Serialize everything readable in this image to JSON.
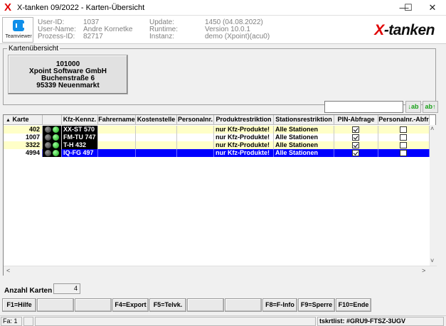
{
  "window": {
    "title": "X-tanken 09/2022 - Karten-Übersicht",
    "app_glyph": "X",
    "controls": {
      "minimize": "—",
      "maximize": "☐",
      "close": "✕"
    }
  },
  "header": {
    "teamviewer_label": "Teamviewer",
    "fields": [
      {
        "label": "User-ID:",
        "value": "1037"
      },
      {
        "label": "User-Name:",
        "value": "Andre Kornetke"
      },
      {
        "label": "Prozess-ID:",
        "value": "82717"
      },
      {
        "label": "Update:",
        "value": "1450 (04.08.2022)"
      },
      {
        "label": "Runtime:",
        "value": "Version 10.0.1"
      },
      {
        "label": "Instanz:",
        "value": "demo (Xpoint)(acu0)"
      }
    ],
    "brand_x": "X",
    "brand_rest": "-tanken"
  },
  "overview": {
    "group_title": "Kartenübersicht",
    "address": [
      "101000",
      "Xpoint Software GmbH",
      "Buchenstraße 6",
      "95339 Neuenmarkt"
    ]
  },
  "search": {
    "value": "",
    "sort_down_label": "↓ab",
    "sort_up_label": "ab↑"
  },
  "grid": {
    "sort_glyph": "▲",
    "columns": [
      "Karte",
      "",
      "Kfz-Kennz.",
      "Fahrername",
      "Kostenstelle",
      "Personalnr.",
      "Produktrestriktion",
      "Stationsrestriktion",
      "PIN-Abfrage",
      "Personalnr.-Abfr"
    ],
    "rows": [
      {
        "karte": "402",
        "lights": [
          "off",
          "on"
        ],
        "kfz": "XX-ST 570",
        "fahrer": "",
        "kst": "",
        "pnr": "",
        "prod": "nur Kfz-Produkte!",
        "station": "Alle Stationen",
        "pin": true,
        "pabfr": false,
        "style": "yellow"
      },
      {
        "karte": "1007",
        "lights": [
          "off",
          "on"
        ],
        "kfz": "FM-TU 747",
        "fahrer": "",
        "kst": "",
        "pnr": "",
        "prod": "nur Kfz-Produkte!",
        "station": "Alle Stationen",
        "pin": true,
        "pabfr": false,
        "style": "white"
      },
      {
        "karte": "3322",
        "lights": [
          "off",
          "on"
        ],
        "kfz": "T-H 432",
        "fahrer": "",
        "kst": "",
        "pnr": "",
        "prod": "nur Kfz-Produkte!",
        "station": "Alle Stationen",
        "pin": true,
        "pabfr": false,
        "style": "yellow"
      },
      {
        "karte": "4994",
        "lights": [
          "off",
          "on"
        ],
        "kfz": "IQ-FG 497",
        "fahrer": "",
        "kst": "",
        "pnr": "",
        "prod": "nur Kfz-Produkte!",
        "station": "Alle Stationen",
        "pin": true,
        "pabfr": false,
        "style": "sel"
      }
    ],
    "scroll_up": "˄",
    "scroll_down": "˅",
    "scroll_left": "<",
    "scroll_right": ">"
  },
  "footer": {
    "count_label": "Anzahl Karten",
    "count_value": "4",
    "fkeys": [
      "F1=Hilfe",
      "",
      "",
      "F4=Export",
      "F5=Telvk.",
      "",
      "",
      "F8=F-Info",
      "F9=Sperre",
      "F10=Ende"
    ],
    "status": {
      "left": "Fa: 1",
      "mid1": "",
      "mid2": "",
      "right": "tskrtlist: #GRU9-FTSZ-3UGV"
    }
  }
}
